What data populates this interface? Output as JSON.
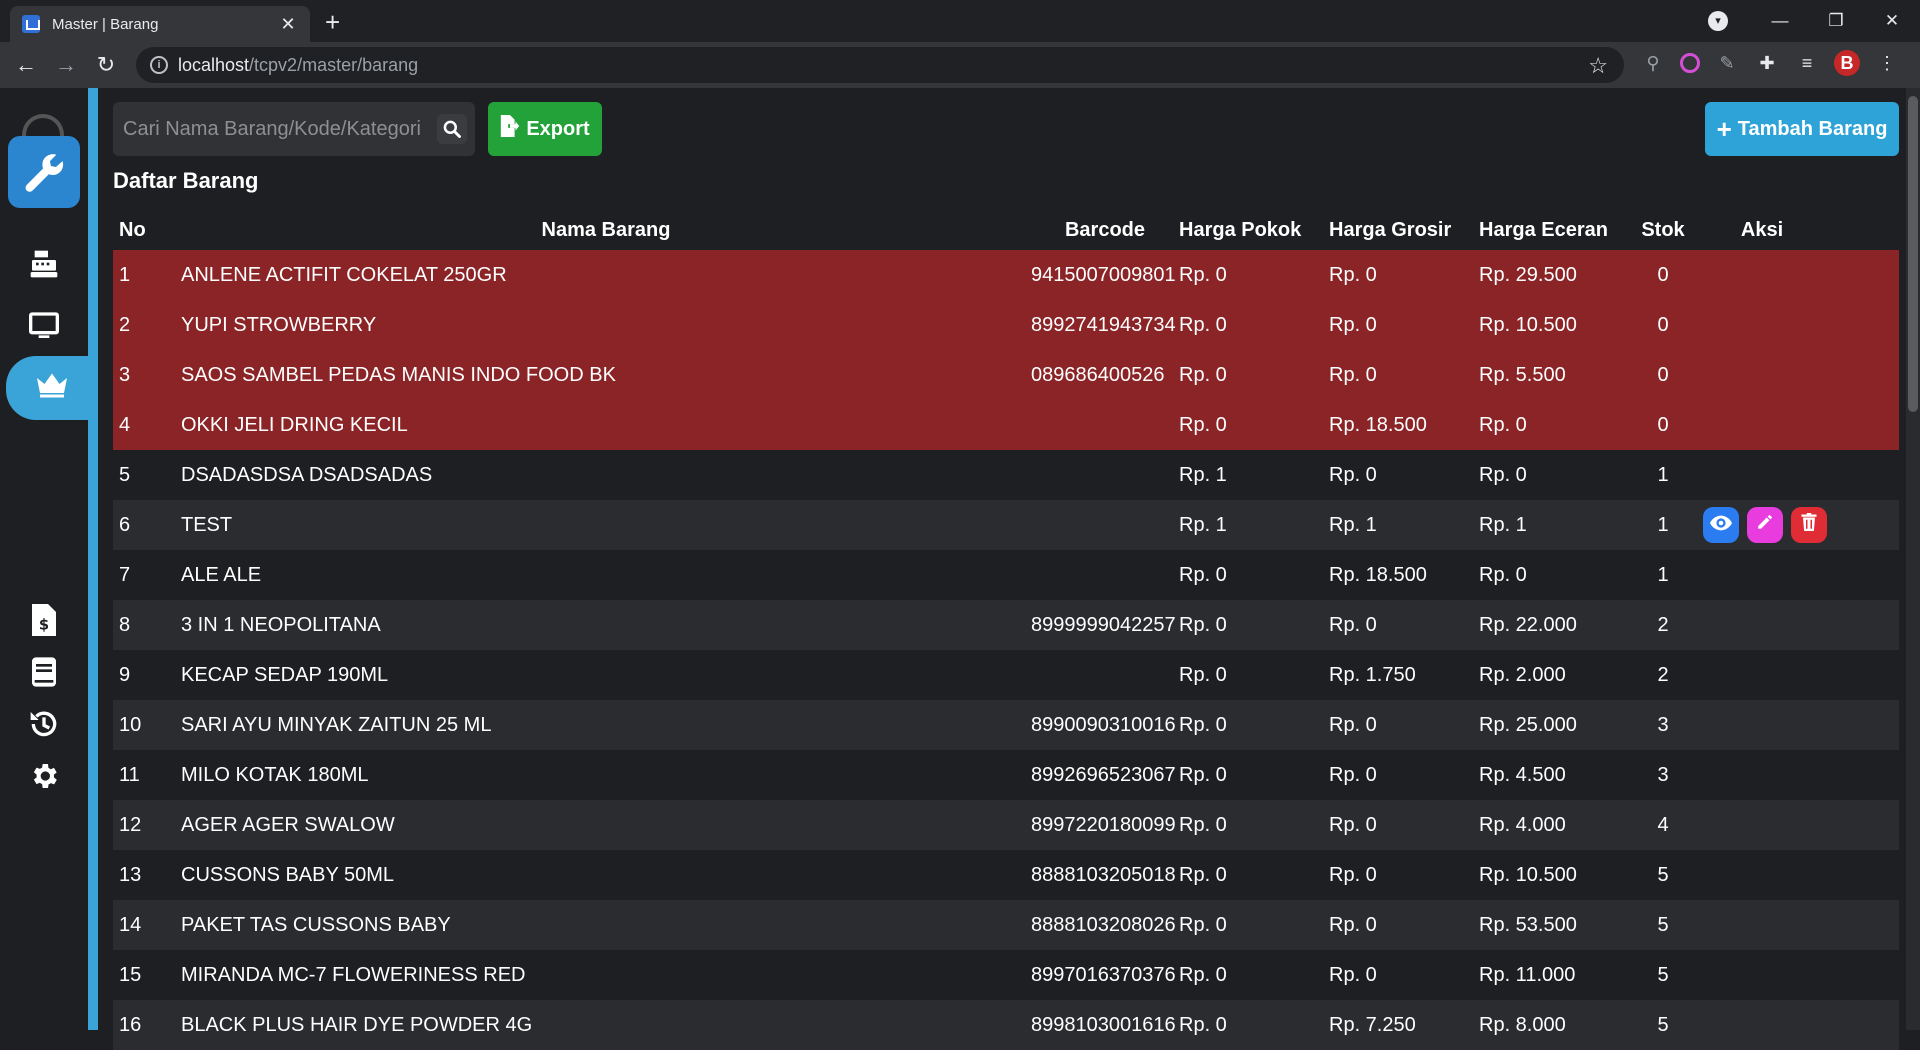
{
  "browser": {
    "tab_title": "Master | Barang",
    "url_host": "localhost",
    "url_path": "/tcpv2/master/barang"
  },
  "sidebar": {
    "items": [
      {
        "icon": "cash-register-icon"
      },
      {
        "icon": "monitor-icon"
      },
      {
        "icon": "crown-icon",
        "active": true
      },
      {
        "icon": "invoice-icon"
      },
      {
        "icon": "book-icon"
      },
      {
        "icon": "history-icon"
      },
      {
        "icon": "gear-icon"
      }
    ]
  },
  "toolbar": {
    "search_placeholder": "Cari Nama Barang/Kode/Kategori",
    "export_label": "Export",
    "add_label": "Tambah Barang"
  },
  "section_title": "Daftar Barang",
  "table": {
    "headers": [
      "No",
      "Nama Barang",
      "Barcode",
      "Harga Pokok",
      "Harga Grosir",
      "Harga Eceran",
      "Stok",
      "Aksi"
    ],
    "rows": [
      {
        "no": "1",
        "nama": "ANLENE ACTIFIT COKELAT 250GR",
        "barcode": "9415007009801",
        "pokok": "Rp. 0",
        "grosir": "Rp. 0",
        "eceran": "Rp. 29.500",
        "stok": "0",
        "status": "alert"
      },
      {
        "no": "2",
        "nama": "YUPI STROWBERRY",
        "barcode": "8992741943734",
        "pokok": "Rp. 0",
        "grosir": "Rp. 0",
        "eceran": "Rp. 10.500",
        "stok": "0",
        "status": "alert"
      },
      {
        "no": "3",
        "nama": "SAOS SAMBEL PEDAS MANIS INDO FOOD BK",
        "barcode": "089686400526",
        "pokok": "Rp. 0",
        "grosir": "Rp. 0",
        "eceran": "Rp. 5.500",
        "stok": "0",
        "status": "alert"
      },
      {
        "no": "4",
        "nama": "OKKI JELI DRING KECIL",
        "barcode": "",
        "pokok": "Rp. 0",
        "grosir": "Rp. 18.500",
        "eceran": "Rp. 0",
        "stok": "0",
        "status": "alert"
      },
      {
        "no": "5",
        "nama": "DSADASDSA DSADSADAS",
        "barcode": "",
        "pokok": "Rp. 1",
        "grosir": "Rp. 0",
        "eceran": "Rp. 0",
        "stok": "1",
        "status": "normal"
      },
      {
        "no": "6",
        "nama": "TEST",
        "barcode": "",
        "pokok": "Rp. 1",
        "grosir": "Rp. 1",
        "eceran": "Rp. 1",
        "stok": "1",
        "status": "hover"
      },
      {
        "no": "7",
        "nama": "ALE ALE",
        "barcode": "",
        "pokok": "Rp. 0",
        "grosir": "Rp. 18.500",
        "eceran": "Rp. 0",
        "stok": "1",
        "status": "normal"
      },
      {
        "no": "8",
        "nama": "3 IN 1 NEOPOLITANA",
        "barcode": "8999999042257",
        "pokok": "Rp. 0",
        "grosir": "Rp. 0",
        "eceran": "Rp. 22.000",
        "stok": "2",
        "status": "normal"
      },
      {
        "no": "9",
        "nama": "KECAP SEDAP 190ML",
        "barcode": "",
        "pokok": "Rp. 0",
        "grosir": "Rp. 1.750",
        "eceran": "Rp. 2.000",
        "stok": "2",
        "status": "normal"
      },
      {
        "no": "10",
        "nama": "SARI AYU MINYAK ZAITUN 25 ML",
        "barcode": "8990090310016",
        "pokok": "Rp. 0",
        "grosir": "Rp. 0",
        "eceran": "Rp. 25.000",
        "stok": "3",
        "status": "normal"
      },
      {
        "no": "11",
        "nama": "MILO KOTAK 180ML",
        "barcode": "8992696523067",
        "pokok": "Rp. 0",
        "grosir": "Rp. 0",
        "eceran": "Rp. 4.500",
        "stok": "3",
        "status": "normal"
      },
      {
        "no": "12",
        "nama": "AGER AGER SWALOW",
        "barcode": "8997220180099",
        "pokok": "Rp. 0",
        "grosir": "Rp. 0",
        "eceran": "Rp. 4.000",
        "stok": "4",
        "status": "normal"
      },
      {
        "no": "13",
        "nama": "CUSSONS BABY 50ML",
        "barcode": "8888103205018",
        "pokok": "Rp. 0",
        "grosir": "Rp. 0",
        "eceran": "Rp. 10.500",
        "stok": "5",
        "status": "normal"
      },
      {
        "no": "14",
        "nama": "PAKET TAS CUSSONS BABY",
        "barcode": "8888103208026",
        "pokok": "Rp. 0",
        "grosir": "Rp. 0",
        "eceran": "Rp. 53.500",
        "stok": "5",
        "status": "normal"
      },
      {
        "no": "15",
        "nama": "MIRANDA MC-7 FLOWERINESS RED",
        "barcode": "8997016370376",
        "pokok": "Rp. 0",
        "grosir": "Rp. 0",
        "eceran": "Rp. 11.000",
        "stok": "5",
        "status": "normal"
      },
      {
        "no": "16",
        "nama": "BLACK PLUS HAIR DYE POWDER 4G",
        "barcode": "8998103001616",
        "pokok": "Rp. 0",
        "grosir": "Rp. 7.250",
        "eceran": "Rp. 8.000",
        "stok": "5",
        "status": "normal"
      }
    ]
  }
}
